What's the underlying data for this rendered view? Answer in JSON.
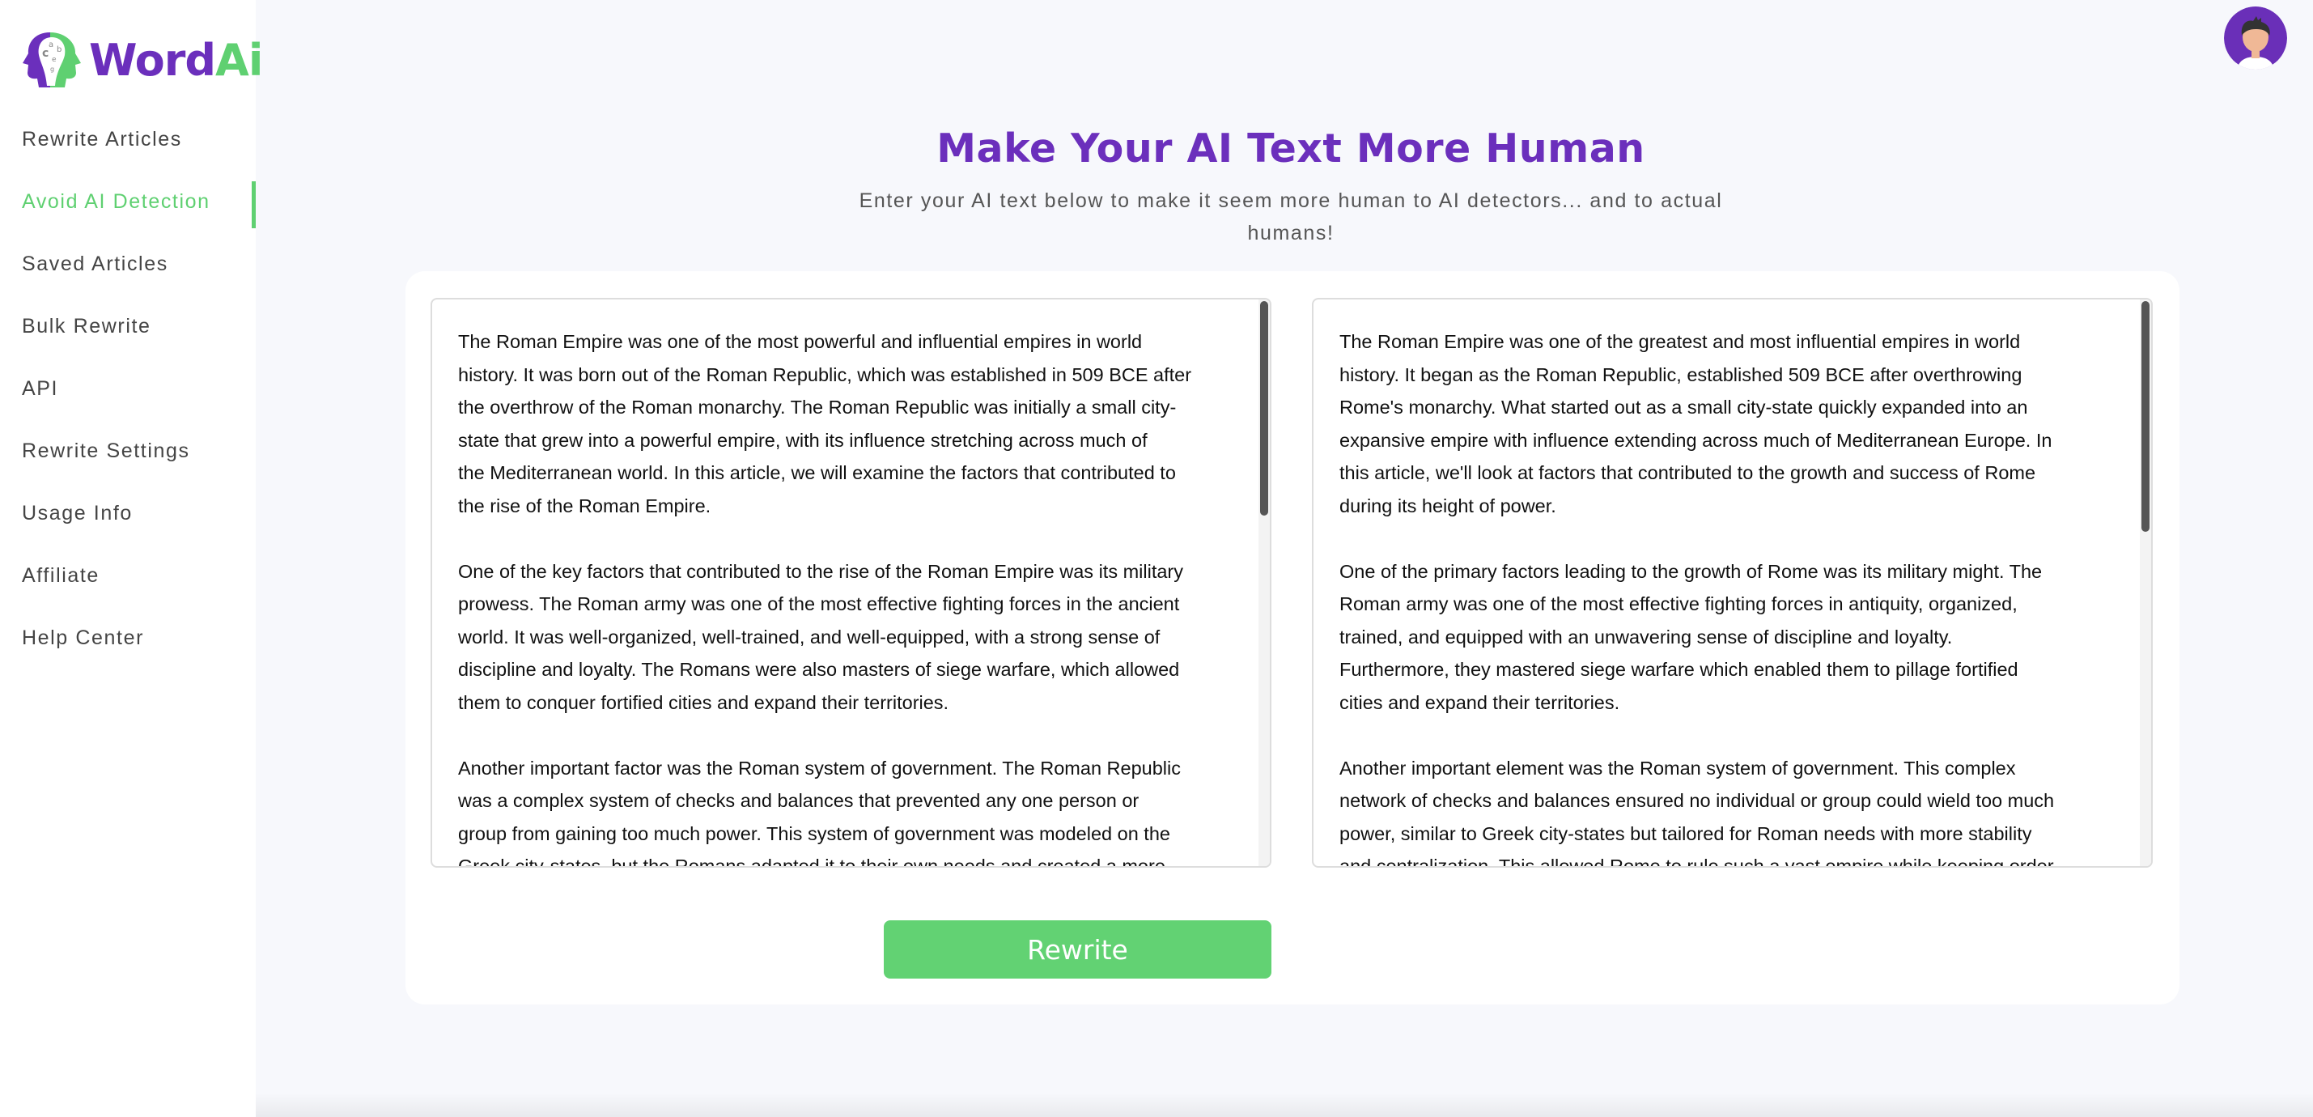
{
  "brand": {
    "word": "Word",
    "ai": "Ai",
    "purple": "#6b2fbc",
    "green": "#5fd071"
  },
  "sidebar": {
    "active_index": 1,
    "items": [
      {
        "label": "Rewrite Articles"
      },
      {
        "label": "Avoid AI Detection"
      },
      {
        "label": "Saved Articles"
      },
      {
        "label": "Bulk Rewrite"
      },
      {
        "label": "API"
      },
      {
        "label": "Rewrite Settings"
      },
      {
        "label": "Usage Info"
      },
      {
        "label": "Affiliate"
      },
      {
        "label": "Help Center"
      }
    ]
  },
  "header": {
    "avatar_icon": "user-avatar-icon"
  },
  "main": {
    "title": "Make Your AI Text More Human",
    "subtitle_line1": "Enter your AI text below to make it seem more human to AI detectors... and to actual",
    "subtitle_line2": "humans!",
    "input_text": [
      [
        "The Roman Empire was one of the most powerful and influential empires in world",
        "history. It was born out of the Roman Republic, which was established in 509 BCE after",
        "the overthrow of the Roman monarchy. The Roman Republic was initially a small city-",
        "state that grew into a powerful empire, with its influence stretching across much of",
        "the Mediterranean world. In this article, we will examine the factors that contributed to",
        "the rise of the Roman Empire."
      ],
      [
        "One of the key factors that contributed to the rise of the Roman Empire was its military",
        "prowess. The Roman army was one of the most effective fighting forces in the ancient",
        "world. It was well-organized, well-trained, and well-equipped, with a strong sense of",
        "discipline and loyalty. The Romans were also masters of siege warfare, which allowed",
        "them to conquer fortified cities and expand their territories."
      ],
      [
        "Another important factor was the Roman system of government. The Roman Republic",
        "was a complex system of checks and balances that prevented any one person or",
        "group from gaining too much power. This system of government was modeled on the",
        "Greek city-states, but the Romans adapted it to their own needs and created a more"
      ]
    ],
    "output_text": [
      [
        "The Roman Empire was one of the greatest and most influential empires in world",
        "history. It began as the Roman Republic, established 509 BCE after overthrowing",
        "Rome's monarchy. What started out as a small city-state quickly expanded into an",
        "expansive empire with influence extending across much of Mediterranean Europe. In",
        "this article, we'll look at factors that contributed to the growth and success of Rome",
        "during its height of power."
      ],
      [
        "One of the primary factors leading to the growth of Rome was its military might. The",
        "Roman army was one of the most effective fighting forces in antiquity, organized,",
        "trained, and equipped with an unwavering sense of discipline and loyalty.",
        "Furthermore, they mastered siege warfare which enabled them to pillage fortified",
        "cities and expand their territories."
      ],
      [
        "Another important element was the Roman system of government. This complex",
        "network of checks and balances ensured no individual or group could wield too much",
        "power, similar to Greek city-states but tailored for Roman needs with more stability",
        "and centralization. This allowed Rome to rule such a vast empire while keeping order"
      ]
    ],
    "rewrite_label": "Rewrite"
  }
}
